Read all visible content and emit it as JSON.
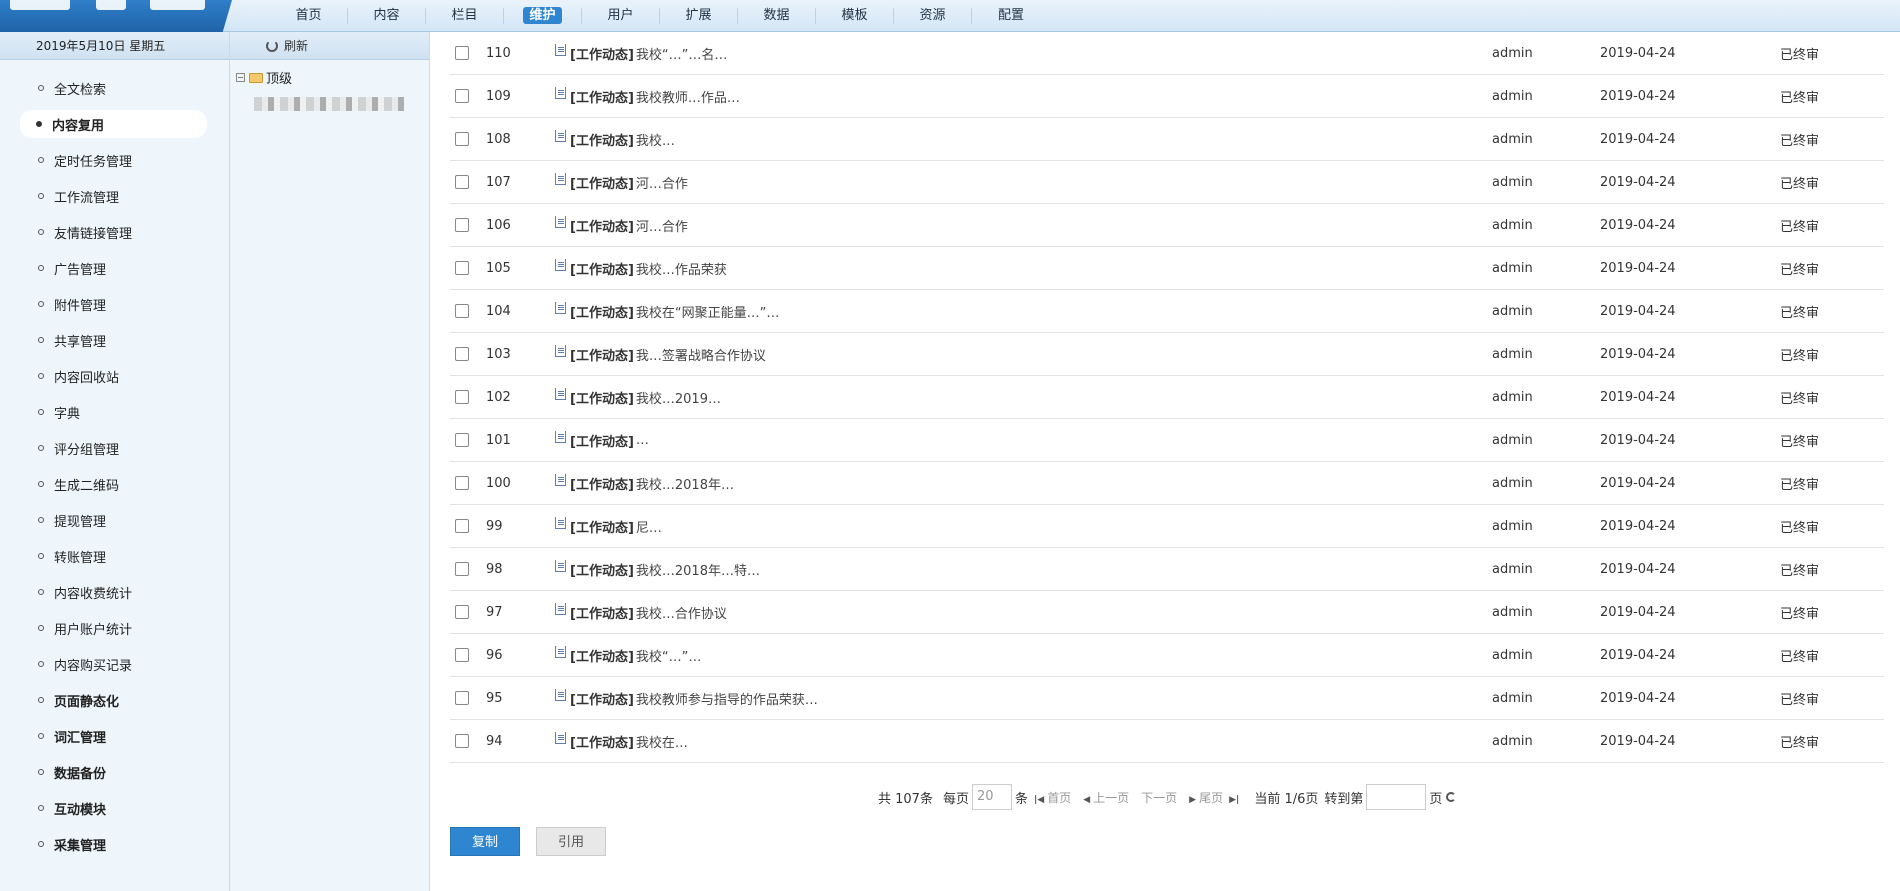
{
  "nav": {
    "items": [
      "首页",
      "内容",
      "栏目",
      "维护",
      "用户",
      "扩展",
      "数据",
      "模板",
      "资源",
      "配置"
    ],
    "active": "维护"
  },
  "sidebar": {
    "date": "2019年5月10日 星期五",
    "items": [
      {
        "label": "全文检索"
      },
      {
        "label": "内容复用"
      },
      {
        "label": "定时任务管理"
      },
      {
        "label": "工作流管理"
      },
      {
        "label": "友情链接管理"
      },
      {
        "label": "广告管理"
      },
      {
        "label": "附件管理"
      },
      {
        "label": "共享管理"
      },
      {
        "label": "内容回收站"
      },
      {
        "label": "字典"
      },
      {
        "label": "评分组管理"
      },
      {
        "label": "生成二维码"
      },
      {
        "label": "提现管理"
      },
      {
        "label": "转账管理"
      },
      {
        "label": "内容收费统计"
      },
      {
        "label": "用户账户统计"
      },
      {
        "label": "内容购买记录"
      },
      {
        "label": "页面静态化"
      },
      {
        "label": "词汇管理"
      },
      {
        "label": "数据备份"
      },
      {
        "label": "互动模块"
      },
      {
        "label": "采集管理"
      }
    ]
  },
  "tree": {
    "refresh_label": "刷新",
    "root_label": "顶级"
  },
  "table": {
    "rows": [
      {
        "id": "110",
        "category": "[工作动态]",
        "title": "我校“…”…名…",
        "author": "admin",
        "date": "2019-04-24",
        "status": "已终审"
      },
      {
        "id": "109",
        "category": "[工作动态]",
        "title": "我校教师…作品…",
        "author": "admin",
        "date": "2019-04-24",
        "status": "已终审"
      },
      {
        "id": "108",
        "category": "[工作动态]",
        "title": "我校…",
        "author": "admin",
        "date": "2019-04-24",
        "status": "已终审"
      },
      {
        "id": "107",
        "category": "[工作动态]",
        "title": "河…合作",
        "author": "admin",
        "date": "2019-04-24",
        "status": "已终审"
      },
      {
        "id": "106",
        "category": "[工作动态]",
        "title": "河…合作",
        "author": "admin",
        "date": "2019-04-24",
        "status": "已终审"
      },
      {
        "id": "105",
        "category": "[工作动态]",
        "title": "我校…作品荣获",
        "author": "admin",
        "date": "2019-04-24",
        "status": "已终审"
      },
      {
        "id": "104",
        "category": "[工作动态]",
        "title": "我校在“网聚正能量…”…",
        "author": "admin",
        "date": "2019-04-24",
        "status": "已终审"
      },
      {
        "id": "103",
        "category": "[工作动态]",
        "title": "我…签署战略合作协议",
        "author": "admin",
        "date": "2019-04-24",
        "status": "已终审"
      },
      {
        "id": "102",
        "category": "[工作动态]",
        "title": "我校…2019…",
        "author": "admin",
        "date": "2019-04-24",
        "status": "已终审"
      },
      {
        "id": "101",
        "category": "[工作动态]",
        "title": "…",
        "author": "admin",
        "date": "2019-04-24",
        "status": "已终审"
      },
      {
        "id": "100",
        "category": "[工作动态]",
        "title": "我校…2018年…",
        "author": "admin",
        "date": "2019-04-24",
        "status": "已终审"
      },
      {
        "id": "99",
        "category": "[工作动态]",
        "title": "尼…",
        "author": "admin",
        "date": "2019-04-24",
        "status": "已终审"
      },
      {
        "id": "98",
        "category": "[工作动态]",
        "title": "我校…2018年…特…",
        "author": "admin",
        "date": "2019-04-24",
        "status": "已终审"
      },
      {
        "id": "97",
        "category": "[工作动态]",
        "title": "我校…合作协议",
        "author": "admin",
        "date": "2019-04-24",
        "status": "已终审"
      },
      {
        "id": "96",
        "category": "[工作动态]",
        "title": "我校“…”…",
        "author": "admin",
        "date": "2019-04-24",
        "status": "已终审"
      },
      {
        "id": "95",
        "category": "[工作动态]",
        "title": "我校教师参与指导的作品荣获…",
        "author": "admin",
        "date": "2019-04-24",
        "status": "已终审"
      },
      {
        "id": "94",
        "category": "[工作动态]",
        "title": "我校在…",
        "author": "admin",
        "date": "2019-04-24",
        "status": "已终审"
      }
    ]
  },
  "pager": {
    "total": "共 107条",
    "per_page_label": "每页",
    "per_page_value": "20",
    "unit": "条",
    "first": "首页",
    "prev": "上一页",
    "next": "下一页",
    "last": "尾页",
    "current": "当前 1/6页",
    "goto_label": "转到第",
    "goto_suffix": "页"
  },
  "buttons": {
    "copy": "复制",
    "cite": "引用"
  }
}
